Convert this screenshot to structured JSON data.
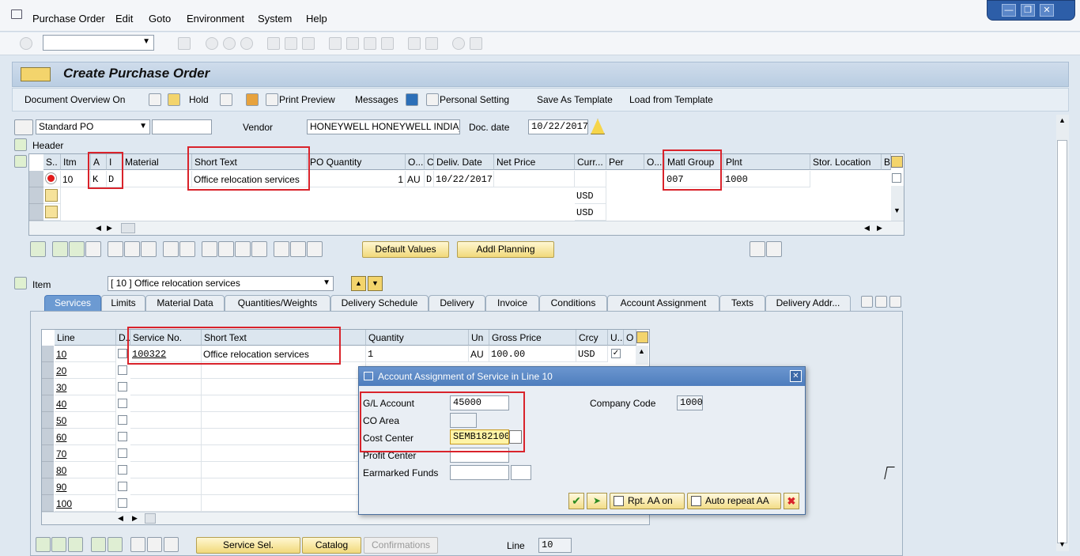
{
  "menu": {
    "items": [
      "Purchase Order",
      "Edit",
      "Goto",
      "Environment",
      "System",
      "Help"
    ]
  },
  "window": {
    "title": "Create Purchase Order"
  },
  "toolbar": {
    "document_overview": "Document Overview On",
    "hold": "Hold",
    "print_preview": "Print Preview",
    "messages": "Messages",
    "personal_setting": "Personal Setting",
    "save_template": "Save As Template",
    "load_template": "Load from Template"
  },
  "header": {
    "po_type": "Standard PO",
    "vendor_label": "Vendor",
    "vendor_value": "HONEYWELL HONEYWELL INDIA_",
    "doc_date_label": "Doc. date",
    "doc_date_value": "10/22/2017",
    "header_label": "Header"
  },
  "items_table": {
    "columns": [
      "S..",
      "Itm",
      "A",
      "I",
      "Material",
      "Short Text",
      "PO Quantity",
      "O...",
      "C",
      "Deliv. Date",
      "Net Price",
      "Curr...",
      "Per",
      "O...",
      "Matl Group",
      "Plnt",
      "Stor. Location",
      "B"
    ],
    "row1": {
      "itm": "10",
      "a": "K",
      "i": "D",
      "short_text": "Office relocation services",
      "qty": "1",
      "ou": "AU",
      "c": "D",
      "deliv": "10/22/2017",
      "matl_group": "007",
      "plant": "1000"
    },
    "row2": {
      "curr": "USD"
    },
    "row3": {
      "curr": "USD"
    }
  },
  "buttons": {
    "default_values": "Default Values",
    "addl_planning": "Addl Planning"
  },
  "item_detail": {
    "label": "Item",
    "selected": "[ 10 ] Office relocation services"
  },
  "tabs": [
    "Services",
    "Limits",
    "Material Data",
    "Quantities/Weights",
    "Delivery Schedule",
    "Delivery",
    "Invoice",
    "Conditions",
    "Account Assignment",
    "Texts",
    "Delivery Addr..."
  ],
  "services": {
    "columns": [
      "Line",
      "D..",
      "Service No.",
      "Short Text",
      "Quantity",
      "Un",
      "Gross Price",
      "Crcy",
      "U..",
      "O"
    ],
    "lines": [
      "10",
      "20",
      "30",
      "40",
      "50",
      "60",
      "70",
      "80",
      "90",
      "100"
    ],
    "row1": {
      "service_no": "100322",
      "short_text": "Office relocation services",
      "quantity": "1",
      "un": "AU",
      "gross_price": "100.00",
      "crcy": "USD"
    }
  },
  "bottom": {
    "service_sel": "Service Sel.",
    "catalog": "Catalog",
    "confirmations": "Confirmations",
    "line_label": "Line",
    "line_value": "10"
  },
  "dialog": {
    "title": "Account Assignment of Service in Line 10",
    "gl_label": "G/L Account",
    "gl_value": "45000",
    "co_area_label": "CO Area",
    "cost_center_label": "Cost Center",
    "cost_center_value": "SEMB182100",
    "profit_center_label": "Profit Center",
    "earmarked_label": "Earmarked Funds",
    "company_code_label": "Company Code",
    "company_code_value": "1000",
    "rpt_aa": "Rpt. AA on",
    "auto_repeat": "Auto repeat AA"
  },
  "colors": {
    "highlight": "#d9232b",
    "title_bar": "#4e7dbd",
    "button": "#f1d97a"
  }
}
